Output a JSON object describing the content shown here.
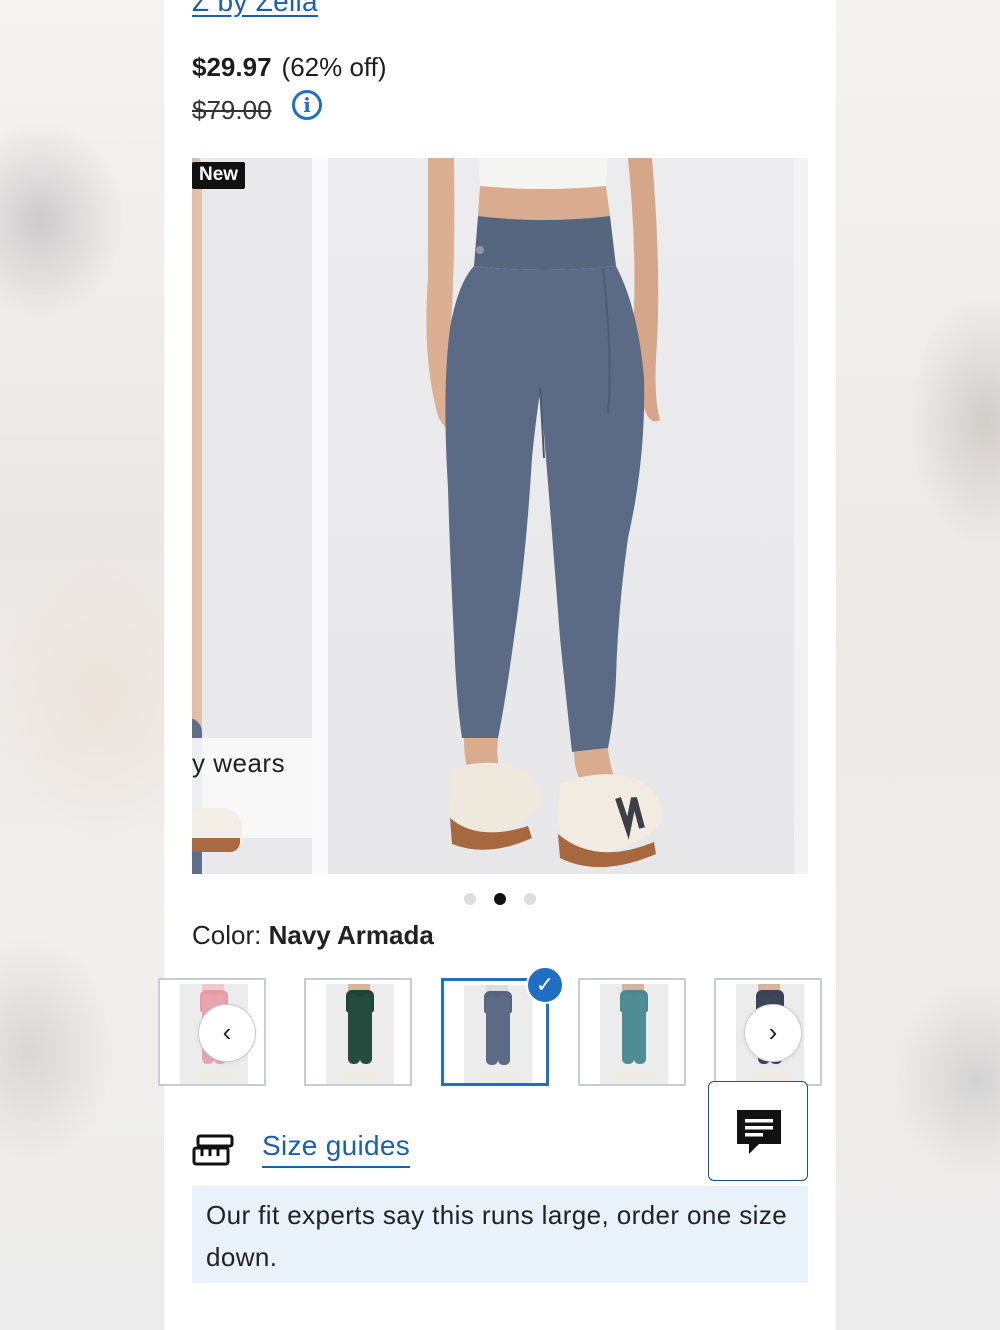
{
  "product": {
    "brand": "Z by Zella",
    "price_current": "$29.97",
    "price_discount": "(62% off)",
    "price_original": "$79.00",
    "info_icon": "info-icon"
  },
  "gallery": {
    "badge": "New",
    "prev_slide_caption": "y wears",
    "slide_count": 3,
    "active_slide_index": 1
  },
  "color": {
    "label": "Color: ",
    "value": "Navy Armada"
  },
  "swatches": {
    "items": [
      {
        "name": "pink",
        "colors": {
          "pant": "#e7a6ad",
          "waist": "#e99aa6",
          "top": "#f1c8cc"
        }
      },
      {
        "name": "forest-green",
        "colors": {
          "pant": "#244b3e",
          "waist": "#1f4337",
          "top": "#d9b39a"
        }
      },
      {
        "name": "navy-armada",
        "colors": {
          "pant": "#5b6b85",
          "waist": "#55657f",
          "top": "#dcdcdc"
        }
      },
      {
        "name": "teal",
        "colors": {
          "pant": "#4f8c93",
          "waist": "#4b8990",
          "top": "#d9b39a"
        }
      },
      {
        "name": "charcoal",
        "colors": {
          "pant": "#3d4659",
          "waist": "#38435a",
          "top": "#d9b39a"
        }
      }
    ],
    "selected_index": 2,
    "prev_icon": "chevron-left-icon",
    "next_icon": "chevron-right-icon"
  },
  "chat": {
    "icon": "chat-bubble-icon"
  },
  "size": {
    "icon": "ruler-icon",
    "link": "Size guides"
  },
  "fit_note": "Our fit experts say this runs large, order one size down.",
  "colors": {
    "link_blue": "#1f5fa8",
    "accent_blue": "#1f6fc4",
    "note_bg": "#e9f1fb",
    "legging_navy": "#5b6b85"
  }
}
